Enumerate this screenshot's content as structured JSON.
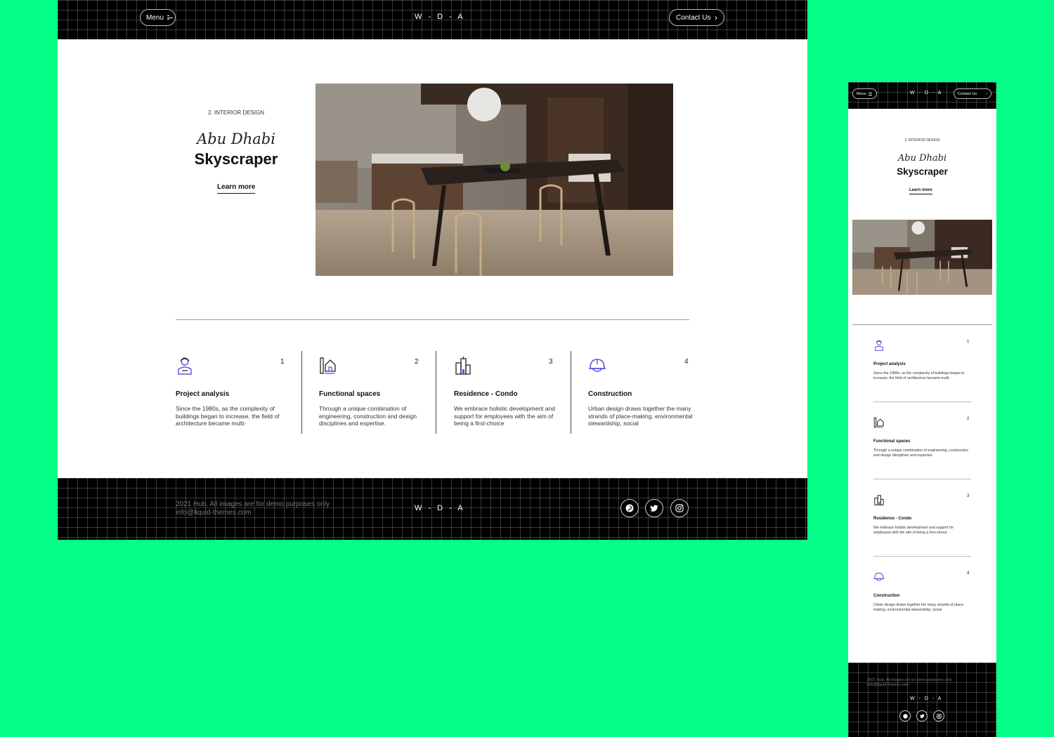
{
  "brand": {
    "logo": "W - D - A"
  },
  "header": {
    "menu_label": "Menu",
    "contact_label": "Contact Us"
  },
  "hero": {
    "label": "2. INTERIOR DESIGN",
    "italic_title": "Abu Dhabi",
    "title": "Skyscraper",
    "link": "Learn more"
  },
  "features": [
    {
      "num": "1",
      "title": "Project analysis",
      "desc": "Since the 1980s, as the complexity of buildings began to increase, the field of architecture became multi-",
      "icon": "worker-icon"
    },
    {
      "num": "2",
      "title": "Functional spaces",
      "desc": "Through a unique combination of engineering, construction and design disciplines and expertise.",
      "icon": "house-plan-icon"
    },
    {
      "num": "3",
      "title": "Residence - Condo",
      "desc": "We embrace holistic development and support for employees with the aim of being a first-choice",
      "icon": "buildings-icon"
    },
    {
      "num": "4",
      "title": "Construction",
      "desc": "Urban design draws together the many strands of place-making, environmental stewardship, social",
      "icon": "helmet-icon"
    }
  ],
  "mobile_features": [
    {
      "desc": "Since the 1980s, as the complexity of buildings began to increase, the field of architecture became multi-"
    },
    {
      "desc": "Through a unique combination of engineering, construction and design disciplines and expertise."
    },
    {
      "desc": "We embrace holistic development and support for employees with the aim of being a first-choice"
    },
    {
      "desc": "Urban design draws together the many strands of place-making, environmental stewardship, social"
    }
  ],
  "footer": {
    "copyright": "2021 Hub. All images are for demo purposes only",
    "email": "info@liquid-themes.com",
    "social": [
      "pinterest-icon",
      "twitter-icon",
      "instagram-icon"
    ]
  },
  "colors": {
    "background": "#05fe85",
    "accent_icon": "#5b53e8",
    "dark": "#000000"
  }
}
